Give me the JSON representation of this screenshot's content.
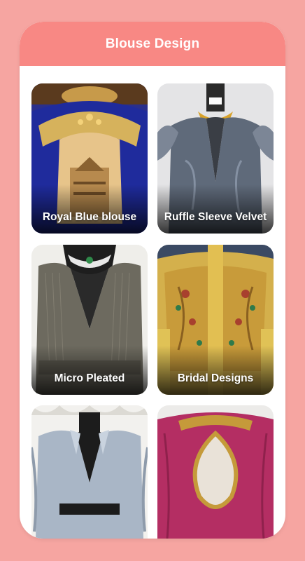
{
  "header": {
    "title": "Blouse Design"
  },
  "theme": {
    "background": "#f6a5a1",
    "header": "#f88884",
    "card_text": "#ffffff"
  },
  "cards": [
    {
      "label": "Royal Blue blouse"
    },
    {
      "label": "Ruffle Sleeve Velvet"
    },
    {
      "label": "Micro Pleated"
    },
    {
      "label": "Bridal Designs"
    },
    {
      "label": ""
    },
    {
      "label": ""
    }
  ]
}
